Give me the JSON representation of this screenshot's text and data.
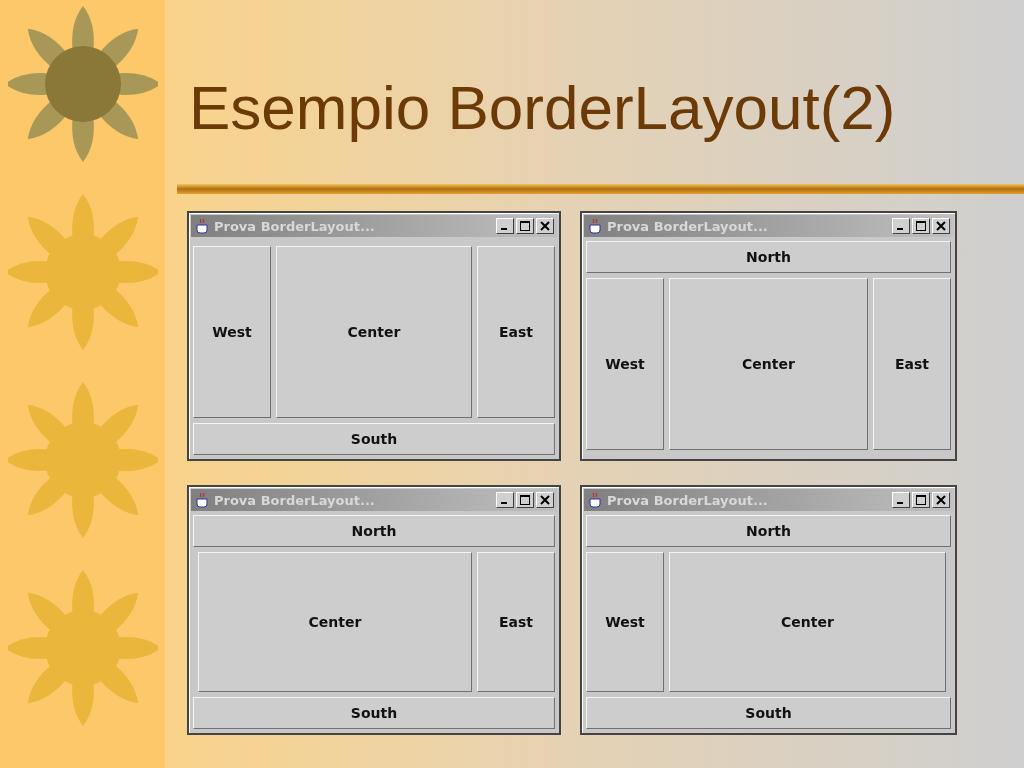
{
  "slide": {
    "title": "Esempio BorderLayout(2)"
  },
  "windows": [
    {
      "title": "Prova BorderLayout...",
      "regions": [
        {
          "kind": "west",
          "label": "West"
        },
        {
          "kind": "center",
          "label": "Center"
        },
        {
          "kind": "east",
          "label": "East"
        },
        {
          "kind": "south",
          "label": "South"
        }
      ]
    },
    {
      "title": "Prova BorderLayout...",
      "regions": [
        {
          "kind": "north",
          "label": "North"
        },
        {
          "kind": "west",
          "label": "West"
        },
        {
          "kind": "center",
          "label": "Center"
        },
        {
          "kind": "east",
          "label": "East"
        }
      ]
    },
    {
      "title": "Prova BorderLayout...",
      "regions": [
        {
          "kind": "north",
          "label": "North"
        },
        {
          "kind": "center",
          "label": "Center"
        },
        {
          "kind": "east",
          "label": "East"
        },
        {
          "kind": "south",
          "label": "South"
        }
      ]
    },
    {
      "title": "Prova BorderLayout...",
      "regions": [
        {
          "kind": "north",
          "label": "North"
        },
        {
          "kind": "west",
          "label": "West"
        },
        {
          "kind": "center",
          "label": "Center"
        },
        {
          "kind": "south",
          "label": "South"
        }
      ]
    }
  ]
}
